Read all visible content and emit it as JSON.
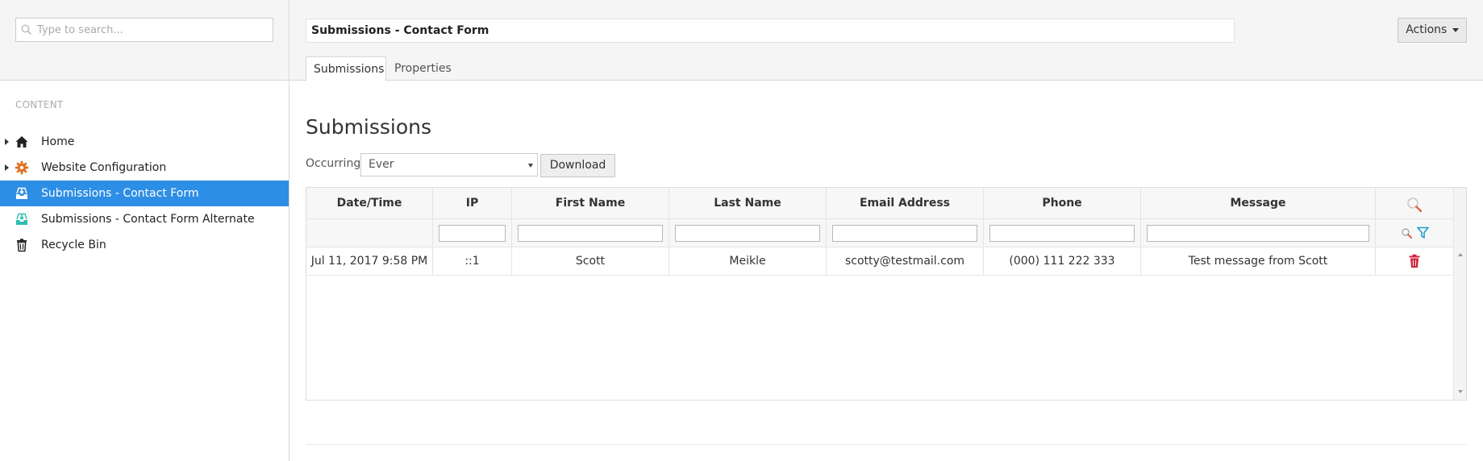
{
  "search": {
    "placeholder": "Type to search..."
  },
  "header": {
    "document_title": "Submissions - Contact Form",
    "actions_label": "Actions",
    "tabs": [
      {
        "label": "Submissions",
        "active": true
      },
      {
        "label": "Properties",
        "active": false
      }
    ]
  },
  "sidebar": {
    "section_label": "CONTENT",
    "items": [
      {
        "label": "Home",
        "icon": "home-icon",
        "expandable": true,
        "selected": false
      },
      {
        "label": "Website Configuration",
        "icon": "gear-icon",
        "expandable": true,
        "selected": false
      },
      {
        "label": "Submissions - Contact Form",
        "icon": "inbox-download-icon",
        "expandable": false,
        "selected": true
      },
      {
        "label": "Submissions - Contact Form Alternate",
        "icon": "inbox-download-icon",
        "expandable": false,
        "selected": false
      },
      {
        "label": "Recycle Bin",
        "icon": "trash-icon",
        "expandable": false,
        "selected": false
      }
    ]
  },
  "main": {
    "heading": "Submissions",
    "occurring_label": "Occurring",
    "occurring_value": "Ever",
    "download_label": "Download",
    "columns": [
      "Date/Time",
      "IP",
      "First Name",
      "Last Name",
      "Email Address",
      "Phone",
      "Message"
    ],
    "rows": [
      [
        "Jul 11, 2017 9:58 PM",
        "::1",
        "Scott",
        "Meikle",
        "scotty@testmail.com",
        "(000) 111 222 333",
        "Test message from Scott"
      ]
    ]
  },
  "colors": {
    "selected_nav": "#2d8ee5",
    "gear_icon": "#e07020",
    "inbox_selected_icon": "#ffffff",
    "inbox_alt_icon": "#2bbfb0",
    "delete_icon": "#d0203a",
    "filter_icon": "#1aa0c8",
    "search_icon_accent": "#e06040"
  }
}
